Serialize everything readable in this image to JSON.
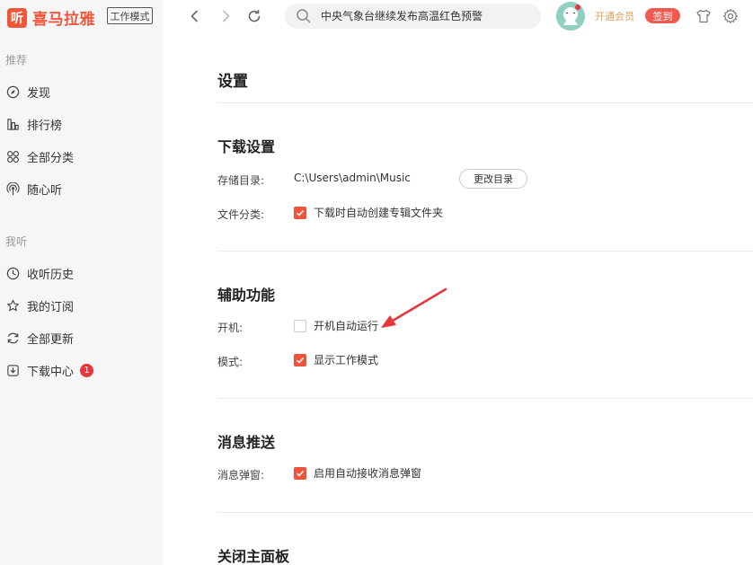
{
  "app": {
    "logo_mark": "听",
    "logo_text": "喜马拉雅",
    "mode_tag": "工作模式"
  },
  "sidebar": {
    "section_recommend": "推荐",
    "recommend_items": [
      {
        "label": "发现",
        "icon": "compass-icon"
      },
      {
        "label": "排行榜",
        "icon": "chart-bar-icon"
      },
      {
        "label": "全部分类",
        "icon": "grid-icon"
      },
      {
        "label": "随心听",
        "icon": "broadcast-icon"
      }
    ],
    "section_mine": "我听",
    "mine_items": [
      {
        "label": "收听历史",
        "icon": "clock-icon"
      },
      {
        "label": "我的订阅",
        "icon": "star-icon"
      },
      {
        "label": "全部更新",
        "icon": "refresh-icon"
      },
      {
        "label": "下载中心",
        "icon": "download-icon",
        "badge": "1"
      }
    ]
  },
  "topbar": {
    "search_placeholder": "中央气象台继续发布高温红色预警",
    "vip_label": "开通会员",
    "checkin_label": "签到"
  },
  "settings": {
    "title": "设置",
    "download": {
      "title": "下载设置",
      "dir_label": "存储目录:",
      "dir_path": "C:\\Users\\admin\\Music",
      "change_dir_button": "更改目录",
      "classify_label": "文件分类:",
      "classify_option": "下载时自动创建专辑文件夹",
      "classify_checked": true
    },
    "assist": {
      "title": "辅助功能",
      "boot_label": "开机:",
      "boot_option": "开机自动运行",
      "boot_checked": false,
      "mode_label": "模式:",
      "mode_option": "显示工作模式",
      "mode_checked": true
    },
    "push": {
      "title": "消息推送",
      "popup_label": "消息弹窗:",
      "popup_option": "启用自动接收消息弹窗",
      "popup_checked": true
    },
    "close_panel": {
      "title": "关闭主面板"
    }
  },
  "colors": {
    "accent": "#f0533b",
    "annotation_arrow": "#e8343b"
  }
}
